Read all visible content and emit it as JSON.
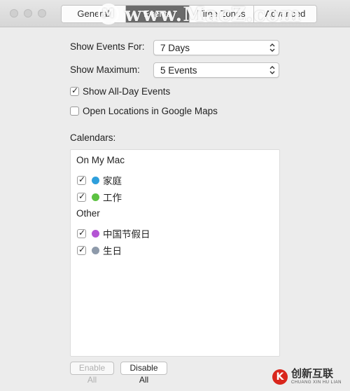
{
  "window": {
    "tabs": [
      {
        "label": "General",
        "active": false
      },
      {
        "label": "Events",
        "active": true
      },
      {
        "label": "Time Zones",
        "active": false
      },
      {
        "label": "Advanced",
        "active": false
      }
    ],
    "watermark": "www.MacZ.com"
  },
  "settings": {
    "show_events_for": {
      "label": "Show Events For:",
      "value": "7 Days"
    },
    "show_maximum": {
      "label": "Show Maximum:",
      "value": "5 Events"
    },
    "all_day": {
      "label": "Show All-Day Events",
      "checked": true
    },
    "google_maps": {
      "label": "Open Locations in Google Maps",
      "checked": false
    }
  },
  "calendars": {
    "label": "Calendars:",
    "groups": [
      {
        "title": "On My Mac",
        "items": [
          {
            "name": "家庭",
            "color": "#2e9fdc",
            "checked": true
          },
          {
            "name": "工作",
            "color": "#5cc242",
            "checked": true
          }
        ]
      },
      {
        "title": "Other",
        "items": [
          {
            "name": "中国节假日",
            "color": "#b455d4",
            "checked": true
          },
          {
            "name": "生日",
            "color": "#8e9aaa",
            "checked": true
          }
        ]
      }
    ]
  },
  "buttons": {
    "enable_all": "Enable All",
    "disable_all": "Disable All"
  },
  "branding": {
    "name": "创新互联",
    "sub": "CHUANG XIN HU LIAN"
  }
}
